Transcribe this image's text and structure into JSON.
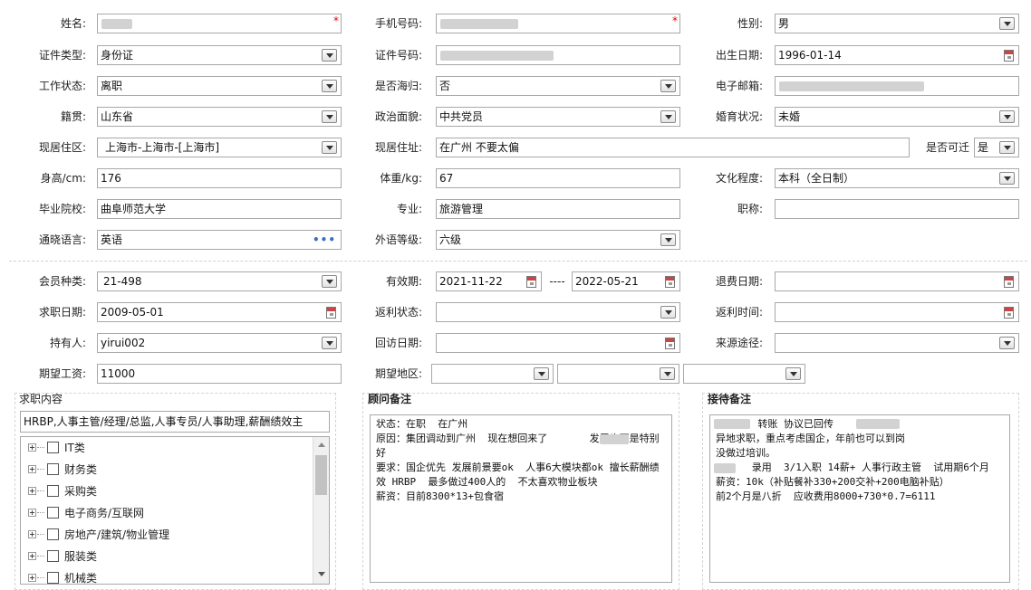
{
  "profile": {
    "name_label": "姓名:",
    "name_value": "",
    "phone_label": "手机号码:",
    "phone_value": "",
    "gender_label": "性别:",
    "gender_value": "男",
    "id_type_label": "证件类型:",
    "id_type_value": "身份证",
    "id_no_label": "证件号码:",
    "id_no_value": "",
    "birth_label": "出生日期:",
    "birth_value": "1996-01-14",
    "work_label": "工作状态:",
    "work_value": "离职",
    "returnee_label": "是否海归:",
    "returnee_value": "否",
    "email_label": "电子邮箱:",
    "email_value": "",
    "native_label": "籍贯:",
    "native_value": "山东省",
    "political_label": "政治面貌:",
    "political_value": "中共党员",
    "marital_label": "婚育状况:",
    "marital_value": "未婚",
    "area_label": "现居住区:",
    "area_value": "上海市-上海市-[上海市]",
    "address_label": "现居住址:",
    "address_value": "在广州 不要太偏",
    "relocate_label": "是否可迁",
    "relocate_value": "是",
    "height_label": "身高/cm:",
    "height_value": "176",
    "weight_label": "体重/kg:",
    "weight_value": "67",
    "edu_label": "文化程度:",
    "edu_value": "本科（全日制）",
    "school_label": "毕业院校:",
    "school_value": "曲阜师范大学",
    "major_label": "专业:",
    "major_value": "旅游管理",
    "title_label": "职称:",
    "title_value": "",
    "lang_label": "通晓语言:",
    "lang_value": "英语",
    "lang_more": "•••",
    "level_label": "外语等级:",
    "level_value": "六级"
  },
  "membership": {
    "type_label": "会员种类:",
    "type_value": "21-498",
    "valid_label": "有效期:",
    "valid_from": "2021-11-22",
    "valid_sep": "----",
    "valid_to": "2022-05-21",
    "refund_label": "退费日期:",
    "refund_value": "",
    "apply_label": "求职日期:",
    "apply_value": "2009-05-01",
    "rebate_label": "返利状态:",
    "rebate_value": "",
    "rebate_time_label": "返利时间:",
    "rebate_time_value": "",
    "holder_label": "持有人:",
    "holder_value": "yirui002",
    "visit_label": "回访日期:",
    "visit_value": "",
    "source_label": "来源途径:",
    "source_value": "",
    "salary_label": "期望工资:",
    "salary_value": "11000",
    "region_label": "期望地区:"
  },
  "job_content": {
    "title": "求职内容",
    "summary": "HRBP,人事主管/经理/总监,人事专员/人事助理,薪酬绩效主",
    "categories": [
      "IT类",
      "财务类",
      "采购类",
      "电子商务/互联网",
      "房地产/建筑/物业管理",
      "服装类",
      "机械类"
    ]
  },
  "advisor_note": {
    "title": "顾问备注",
    "text": "状态：在职  在广州\n原因：集团调动到广州  现在想回来了       发展也不是特别好\n要求：国企优先 发展前景要ok  人事6大模块都ok 擅长薪酬绩效 HRBP  最多做过400人的  不太喜欢物业板块\n薪资：目前8300*13+包食宿"
  },
  "reception_note": {
    "title": "接待备注",
    "text": "       转账 协议已回传\n异地求职，重点考虑国企，年前也可以到岗\n没做过培训。\n      录用  3/1入职 14薪+ 人事行政主管  试用期6个月\n薪资：10k（补贴餐补330+200交补+200电脑补贴）\n前2个月是八折  应收费用8000+730*0.7=6111"
  }
}
